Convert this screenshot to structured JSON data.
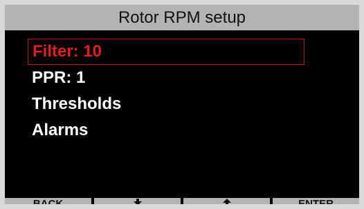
{
  "title": "Rotor RPM setup",
  "menu": {
    "items": [
      {
        "label": "Filter: 10",
        "selected": true
      },
      {
        "label": "PPR: 1",
        "selected": false
      },
      {
        "label": "Thresholds",
        "selected": false
      },
      {
        "label": "Alarms",
        "selected": false
      }
    ]
  },
  "softkeys": {
    "back_label": "BACK",
    "down_icon": "arrow-down-icon",
    "up_icon": "arrow-up-icon",
    "enter_label": "ENTER"
  },
  "colors": {
    "screen_background": "#000000",
    "title_bar": "#b3b3b3",
    "selected_text": "#e41e1e",
    "selected_border": "#c41616",
    "menu_text": "#ffffff",
    "softkey_background": "#b3b3b3"
  }
}
